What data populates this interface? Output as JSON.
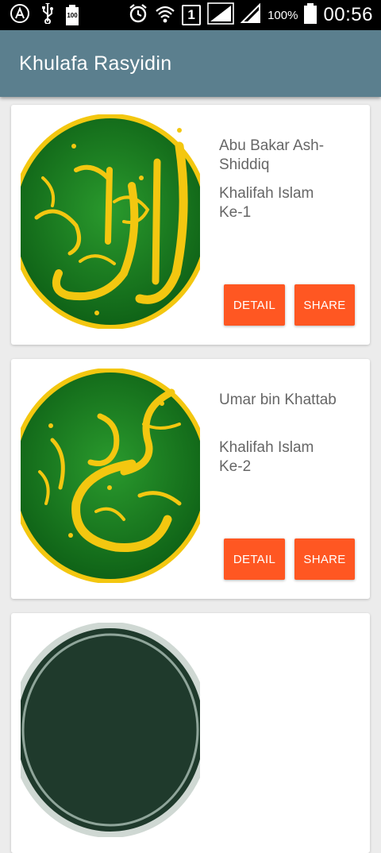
{
  "status_bar": {
    "battery_small": "100",
    "sim": "1",
    "battery_pct": "100%",
    "time": "00:56",
    "icons": [
      "app-logo-icon",
      "usb-icon",
      "battery-full-icon",
      "alarm-icon",
      "wifi-icon",
      "signal-icon",
      "signal-icon",
      "battery-icon"
    ]
  },
  "toolbar": {
    "title": "Khulafa Rasyidin",
    "color": "#5b7f8e"
  },
  "cards": [
    {
      "name": "Abu Bakar Ash-Shiddiq",
      "role": "Khalifah Islam Ke-1",
      "detail_label": "DETAIL",
      "share_label": "SHARE",
      "image": "abu-bakar-calligraphy"
    },
    {
      "name": "Umar bin Khattab",
      "role": "Khalifah Islam Ke-2",
      "detail_label": "DETAIL",
      "share_label": "SHARE",
      "image": "umar-calligraphy"
    }
  ],
  "colors": {
    "accent": "#ff5722",
    "calligraphy_bg": "#157a1e",
    "calligraphy_gold": "#f3c710"
  }
}
